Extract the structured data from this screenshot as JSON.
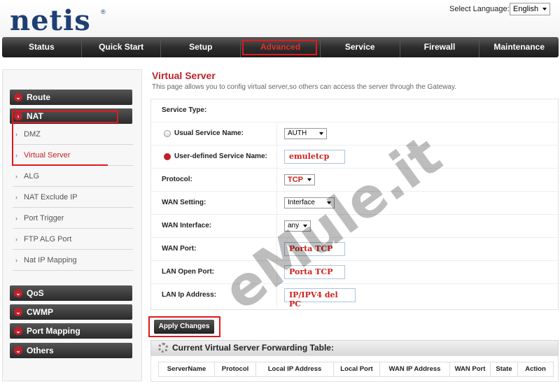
{
  "header": {
    "logo": "netis",
    "language_label": "Select Language:",
    "language_value": "English"
  },
  "nav": {
    "items": [
      "Status",
      "Quick Start",
      "Setup",
      "Advanced",
      "Service",
      "Firewall",
      "Maintenance"
    ],
    "active": "Advanced"
  },
  "sidebar": {
    "sections": {
      "route": "Route",
      "nat": "NAT",
      "qos": "QoS",
      "cwmp": "CWMP",
      "port_mapping": "Port Mapping",
      "others": "Others"
    },
    "nat_items": [
      "DMZ",
      "Virtual Server",
      "ALG",
      "NAT Exclude IP",
      "Port Trigger",
      "FTP ALG Port",
      "Nat IP Mapping"
    ],
    "current_item": "Virtual Server"
  },
  "main": {
    "title": "Virtual Server",
    "description": "This page allows you to config virtual server,so others can access the server through the Gateway.",
    "form": {
      "service_type_label": "Service Type:",
      "usual_service_label": "Usual Service Name:",
      "usual_service_value": "AUTH",
      "user_defined_label": "User-defined Service Name:",
      "user_defined_value": "emuletcp",
      "protocol_label": "Protocol:",
      "protocol_value": "TCP",
      "wan_setting_label": "WAN Setting:",
      "wan_setting_value": "Interface",
      "wan_interface_label": "WAN Interface:",
      "wan_interface_value": "any",
      "wan_port_label": "WAN Port:",
      "wan_port_value": "Porta TCP",
      "lan_open_port_label": "LAN Open Port:",
      "lan_open_port_value": "Porta TCP",
      "lan_ip_label": "LAN Ip Address:",
      "lan_ip_value": "IP/IPV4 del PC"
    },
    "apply_button": "Apply Changes",
    "table": {
      "title": "Current Virtual Server Forwarding Table:",
      "columns": [
        "ServerName",
        "Protocol",
        "Local IP Address",
        "Local Port",
        "WAN IP Address",
        "WAN Port",
        "State",
        "Action"
      ]
    }
  },
  "watermark": "eMule.it",
  "colors": {
    "accent_red": "#c0202a",
    "annotation_red": "#e0191e",
    "nav_dark": "#2e2e2e",
    "logo_blue": "#1e3f73"
  }
}
